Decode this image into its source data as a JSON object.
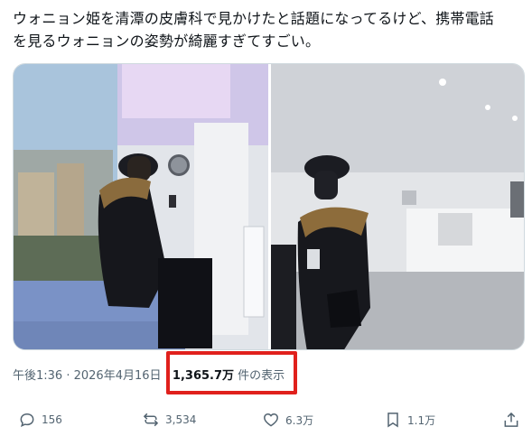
{
  "post": {
    "text_line1": "ウォニョン姫を清潭の皮膚科で見かけたと話題になってるけど、携帯電話",
    "text_line2": "を見るウォニョンの姿勢が綺麗すぎてすごい。"
  },
  "meta": {
    "time": "午後1:36",
    "sep1": " · ",
    "date": "2026年4月16日",
    "sep2": " · ",
    "views_count": "1,365.7万",
    "views_label": " 件の表示"
  },
  "actions": {
    "replies": "156",
    "reposts": "3,534",
    "likes": "6.3万",
    "bookmarks": "1.1万"
  },
  "colors": {
    "text": "#0f1419",
    "muted": "#536471",
    "highlight": "#e0201c"
  },
  "icons": [
    "reply-icon",
    "repost-icon",
    "like-icon",
    "bookmark-icon",
    "share-icon"
  ]
}
